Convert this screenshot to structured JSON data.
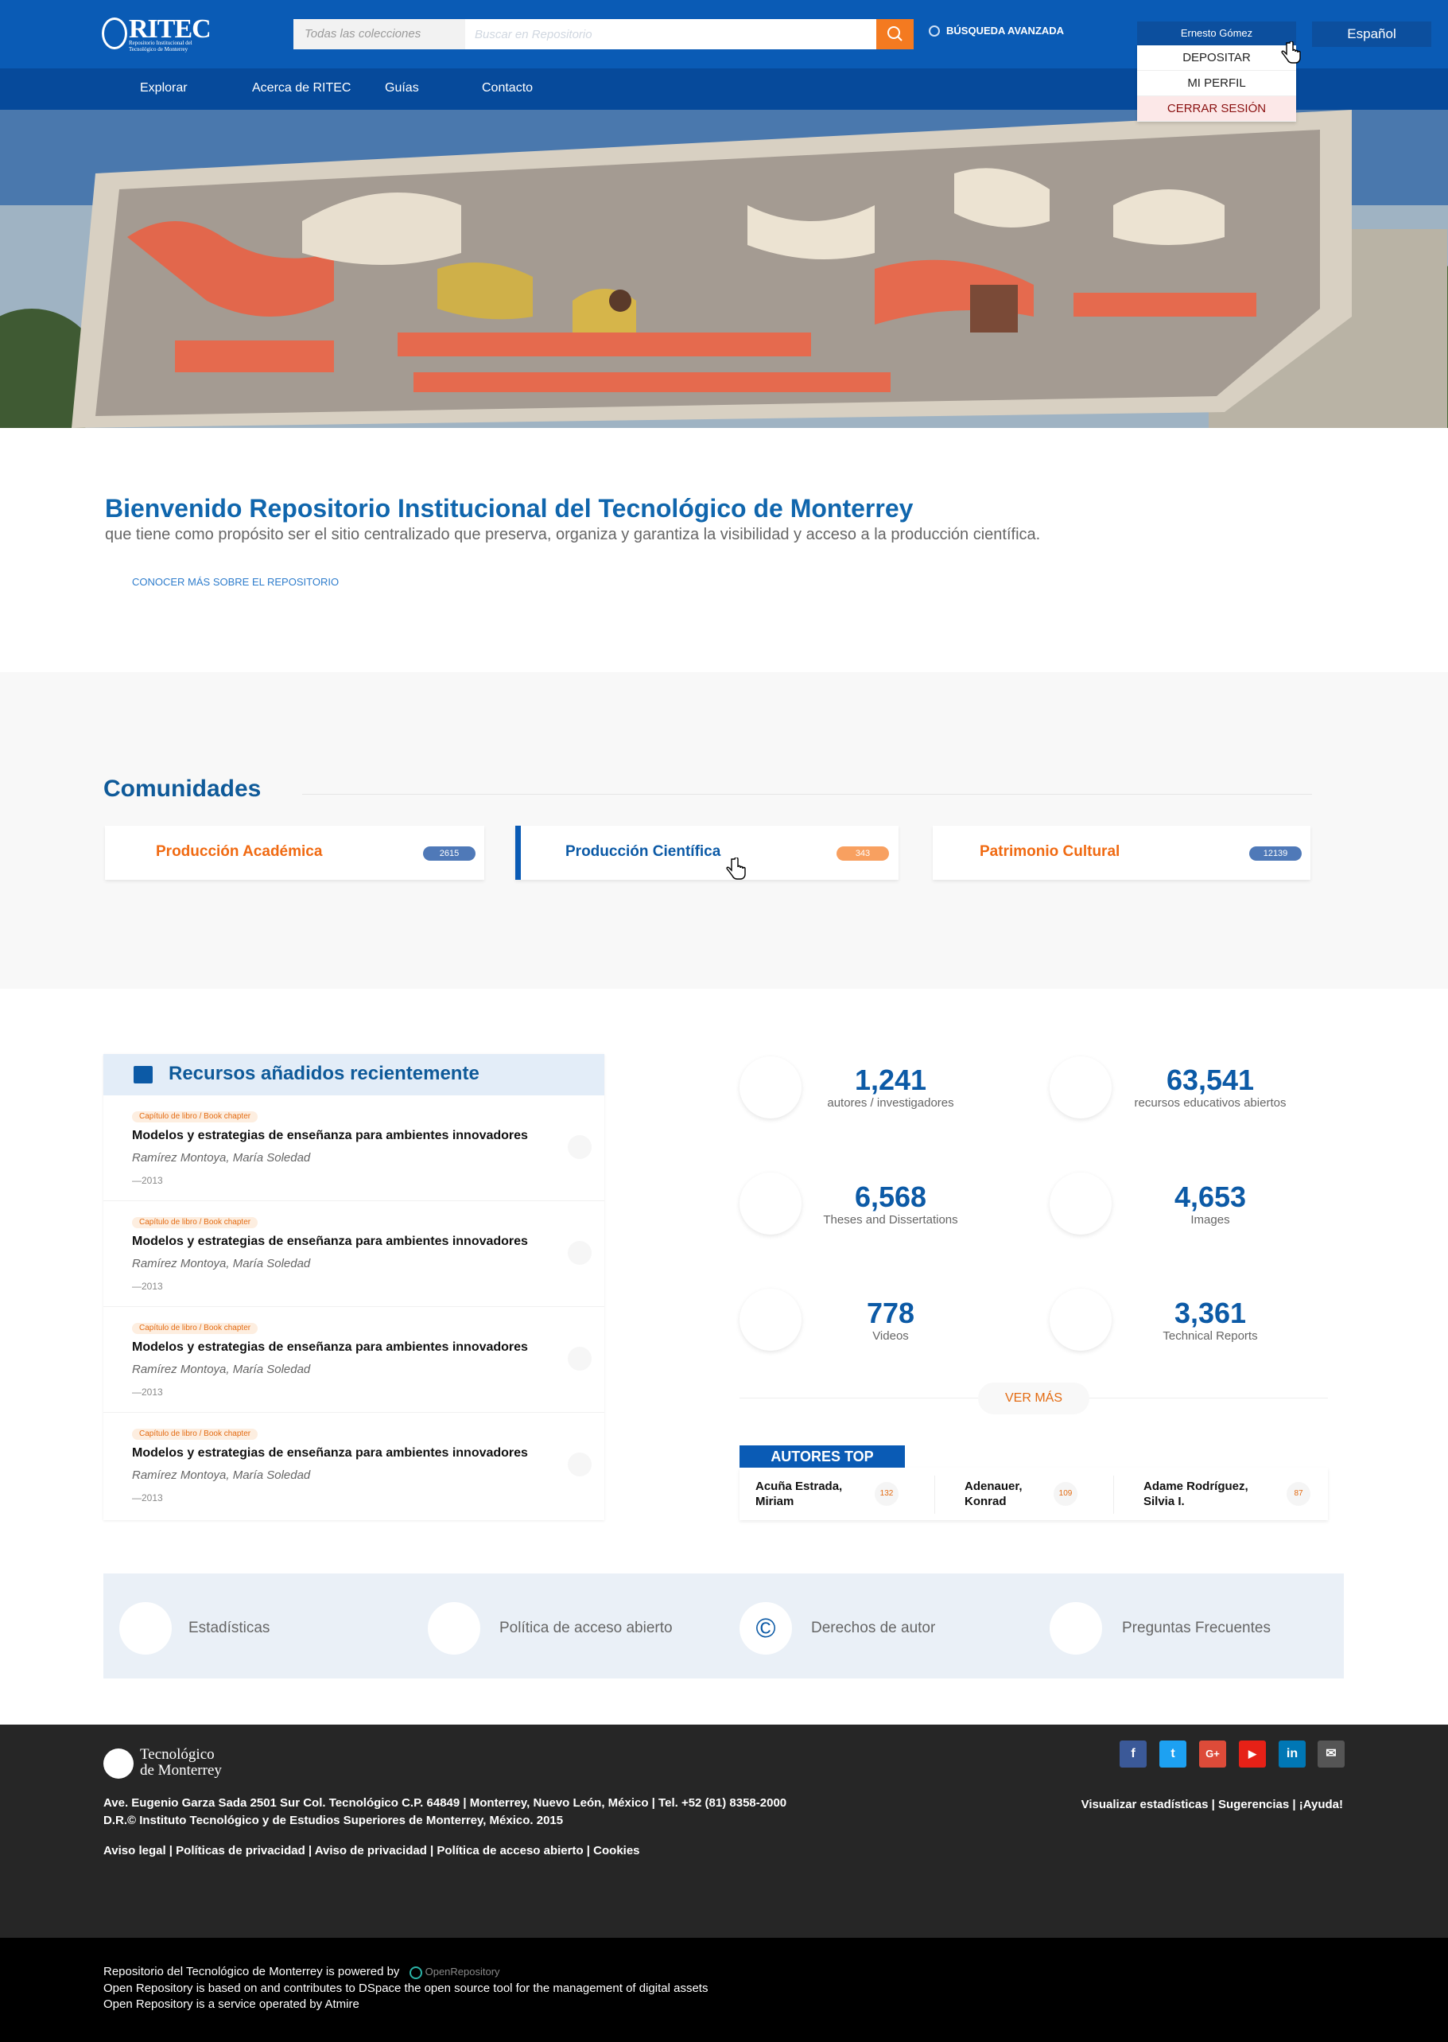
{
  "header": {
    "logo": {
      "title": "RITEC",
      "subtitle": "Repositorio Institucional del Tecnológico de Monterrey"
    },
    "search": {
      "scope": "Todas las colecciones",
      "placeholder": "Buscar en Repositorio",
      "value": ""
    },
    "advanced_search": "BÚSQUEDA AVANZADA",
    "user_name": "Ernesto Gómez",
    "language": "Español",
    "user_menu": [
      "DEPOSITAR",
      "MI PERFIL",
      "CERRAR SESIÓN"
    ]
  },
  "nav": {
    "items": [
      "Explorar",
      "Acerca de RITEC",
      "Guías",
      "Contacto"
    ]
  },
  "welcome": {
    "title": "Bienvenido Repositorio Institucional del Tecnológico de Monterrey",
    "subtitle": "que tiene como propósito ser el sitio centralizado que preserva, organiza y garantiza la visibilidad y acceso a la producción científica.",
    "link": "CONOCER MÁS SOBRE EL REPOSITORIO"
  },
  "communities": {
    "title": "Comunidades",
    "items": [
      {
        "name": "Producción Académica",
        "count": "2615"
      },
      {
        "name": "Producción Científica",
        "count": "343"
      },
      {
        "name": "Patrimonio Cultural",
        "count": "12139"
      }
    ]
  },
  "recent": {
    "title": "Recursos añadidos recientemente",
    "items": [
      {
        "tag": "Capítulo de libro / Book chapter",
        "title": "Modelos y estrategias de enseñanza para ambientes innovadores",
        "author": "Ramírez Montoya, María Soledad",
        "year": "—2013"
      },
      {
        "tag": "Capítulo de libro / Book chapter",
        "title": "Modelos y estrategias de enseñanza para ambientes innovadores",
        "author": "Ramírez Montoya, María Soledad",
        "year": "—2013"
      },
      {
        "tag": "Capítulo de libro / Book chapter",
        "title": "Modelos y estrategias de enseñanza para ambientes innovadores",
        "author": "Ramírez Montoya, María Soledad",
        "year": "—2013"
      },
      {
        "tag": "Capítulo de libro / Book chapter",
        "title": "Modelos y estrategias de enseñanza para ambientes innovadores",
        "author": "Ramírez Montoya, María Soledad",
        "year": "—2013"
      }
    ]
  },
  "stats": [
    {
      "value": "1,241",
      "label": "autores / investigadores"
    },
    {
      "value": "63,541",
      "label": "recursos educativos abiertos"
    },
    {
      "value": "6,568",
      "label": "Theses and Dissertations"
    },
    {
      "value": "4,653",
      "label": "Images"
    },
    {
      "value": "778",
      "label": "Videos"
    },
    {
      "value": "3,361",
      "label": "Technical Reports"
    }
  ],
  "ver_mas": "VER MÁS",
  "top_authors": {
    "title": "AUTORES TOP",
    "items": [
      {
        "name_line1": "Acuña Estrada,",
        "name_line2": "Miriam",
        "count": "132"
      },
      {
        "name_line1": "Adenauer,",
        "name_line2": "Konrad",
        "count": "109"
      },
      {
        "name_line1": "Adame Rodríguez,",
        "name_line2": "Silvia I.",
        "count": "87"
      }
    ]
  },
  "quick_links": [
    {
      "label": "Estadísticas",
      "icon": "chart-icon"
    },
    {
      "label": "Política de acceso abierto",
      "icon": "open-access-icon"
    },
    {
      "label": "Derechos de autor",
      "icon": "copyright-icon",
      "glyph": "©"
    },
    {
      "label": "Preguntas Frecuentes",
      "icon": "faq-icon"
    }
  ],
  "footer": {
    "logo_line1": "Tecnológico",
    "logo_line2": "de Monterrey",
    "address_line1": "Ave. Eugenio Garza Sada 2501 Sur Col. Tecnológico C.P. 64849 | Monterrey, Nuevo León, México | Tel. +52 (81) 8358-2000",
    "address_line2": "D.R.© Instituto Tecnológico y de Estudios Superiores de Monterrey, México. 2015",
    "legal_links": "Aviso legal | Políticas de privacidad | Aviso de privacidad | Política de acceso abierto | Cookies",
    "right_links": "Visualizar estadísticas | Sugerencias |  ¡Ayuda!",
    "social": [
      {
        "icon": "facebook-icon",
        "glyph": "f",
        "color": "#3b5998"
      },
      {
        "icon": "twitter-icon",
        "glyph": "t",
        "color": "#1da1f2"
      },
      {
        "icon": "google-plus-icon",
        "glyph": "G+",
        "color": "#dd4b39"
      },
      {
        "icon": "youtube-icon",
        "glyph": "▶",
        "color": "#e62117"
      },
      {
        "icon": "linkedin-icon",
        "glyph": "in",
        "color": "#0077b5"
      },
      {
        "icon": "email-icon",
        "glyph": "✉",
        "color": "#555555"
      }
    ]
  },
  "subfooter": {
    "line1": "Repositorio del Tecnológico de Monterrey is powered by",
    "brand": "OpenRepository",
    "line2": "Open Repository is based on and contributes to DSpace the open source tool for the management of digital assets",
    "line3": "Open Repository is a service operated by Atmire"
  },
  "colors": {
    "primary": "#0a5bb5",
    "nav": "#064a9b",
    "accent_orange": "#f47a20",
    "community_active_bar": "#0a5bb5",
    "badge_blue": "#4f79b8",
    "badge_orange": "#f8a060"
  }
}
